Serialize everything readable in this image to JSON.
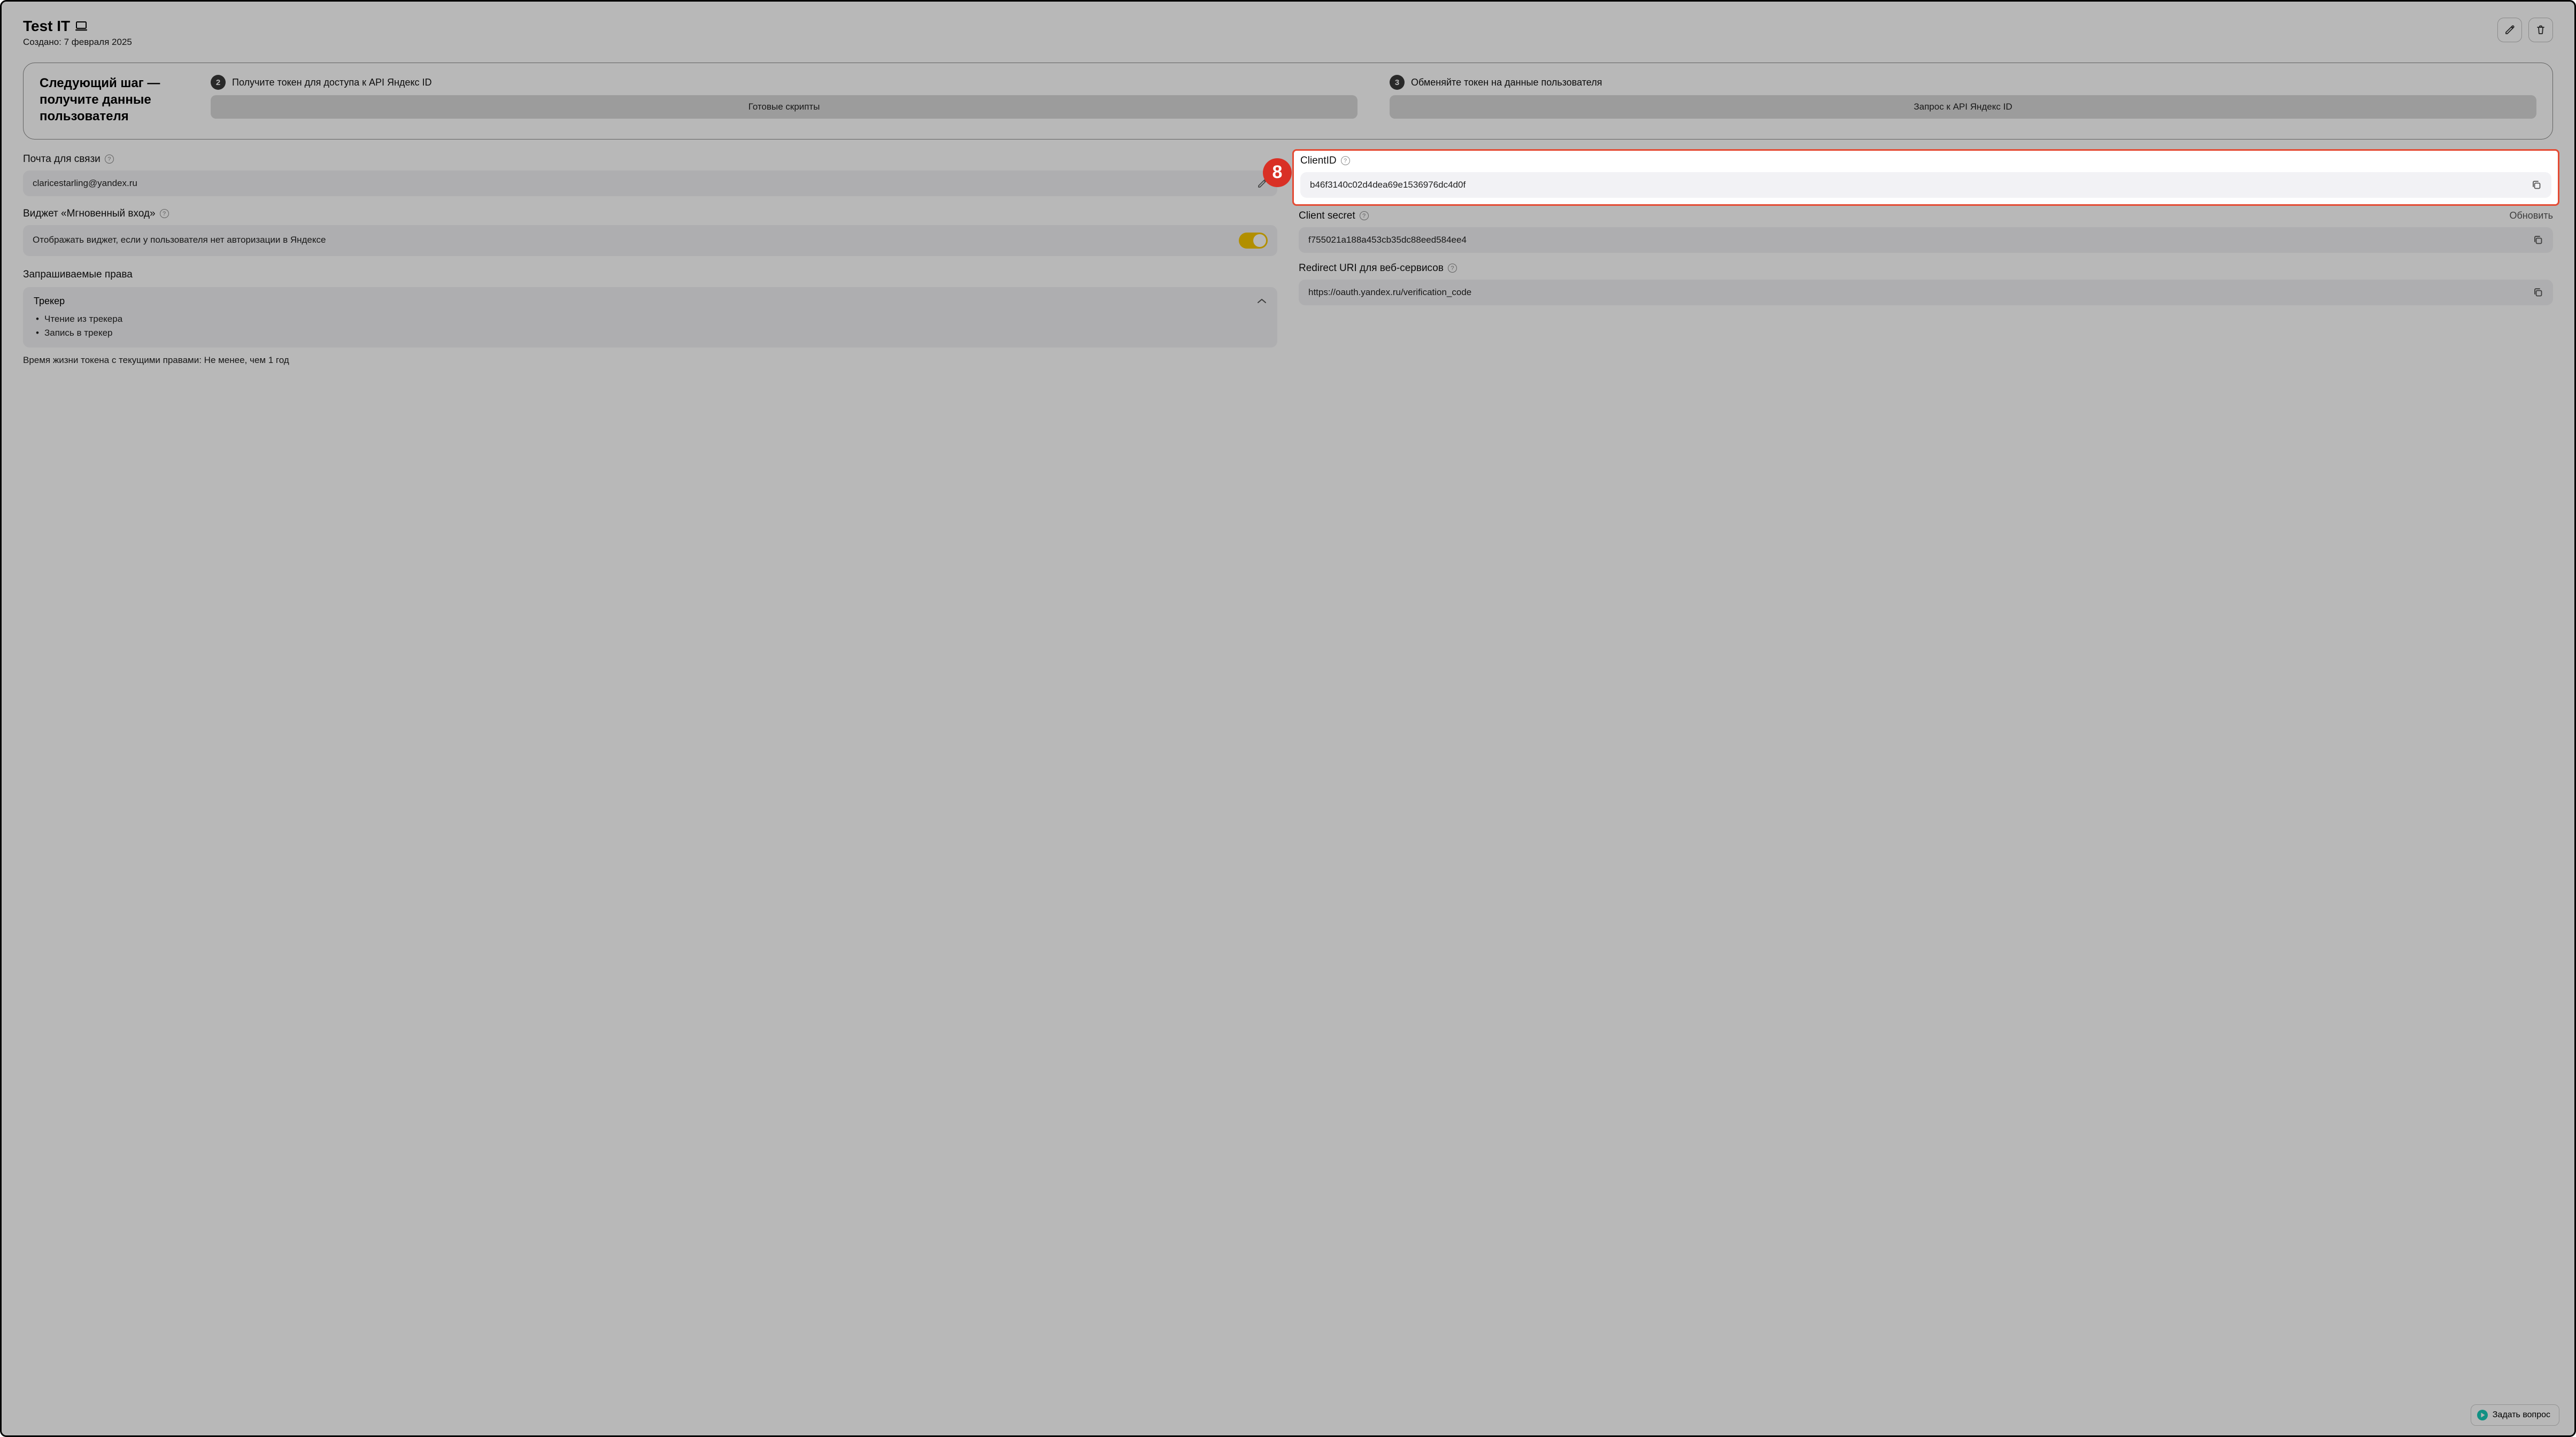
{
  "header": {
    "title": "Test IT",
    "created_prefix": "Создано: ",
    "created_date": "7 февраля 2025"
  },
  "banner": {
    "title": "Следующий шаг — получите данные пользователя",
    "step2": {
      "num": "2",
      "label": "Получите токен для доступа к API Яндекс ID",
      "button": "Готовые скрипты"
    },
    "step3": {
      "num": "3",
      "label": "Обменяйте токен на данные пользователя",
      "button": "Запрос к API Яндекс ID"
    }
  },
  "left": {
    "email_label": "Почта для связи",
    "email_value": "claricestarling@yandex.ru",
    "widget_label": "Виджет «Мгновенный вход»",
    "widget_text": "Отображать виджет, если у пользователя нет авторизации в Яндексе",
    "perm_label": "Запрашиваемые права",
    "perm_group": "Трекер",
    "perm_items": [
      "Чтение из трекера",
      "Запись в трекер"
    ],
    "ttl_note": "Время жизни токена с текущими правами: Не менее, чем 1 год"
  },
  "right": {
    "clientid_label": "ClientID",
    "clientid_value": "b46f3140c02d4dea69e1536976dc4d0f",
    "secret_label": "Client secret",
    "secret_refresh": "Обновить",
    "secret_value": "f755021a188a453cb35dc88eed584ee4",
    "redirect_label": "Redirect URI для веб-сервисов",
    "redirect_value": "https://oauth.yandex.ru/verification_code"
  },
  "callout": {
    "num": "8"
  },
  "ask_button": "Задать вопрос",
  "help_glyph": "?"
}
